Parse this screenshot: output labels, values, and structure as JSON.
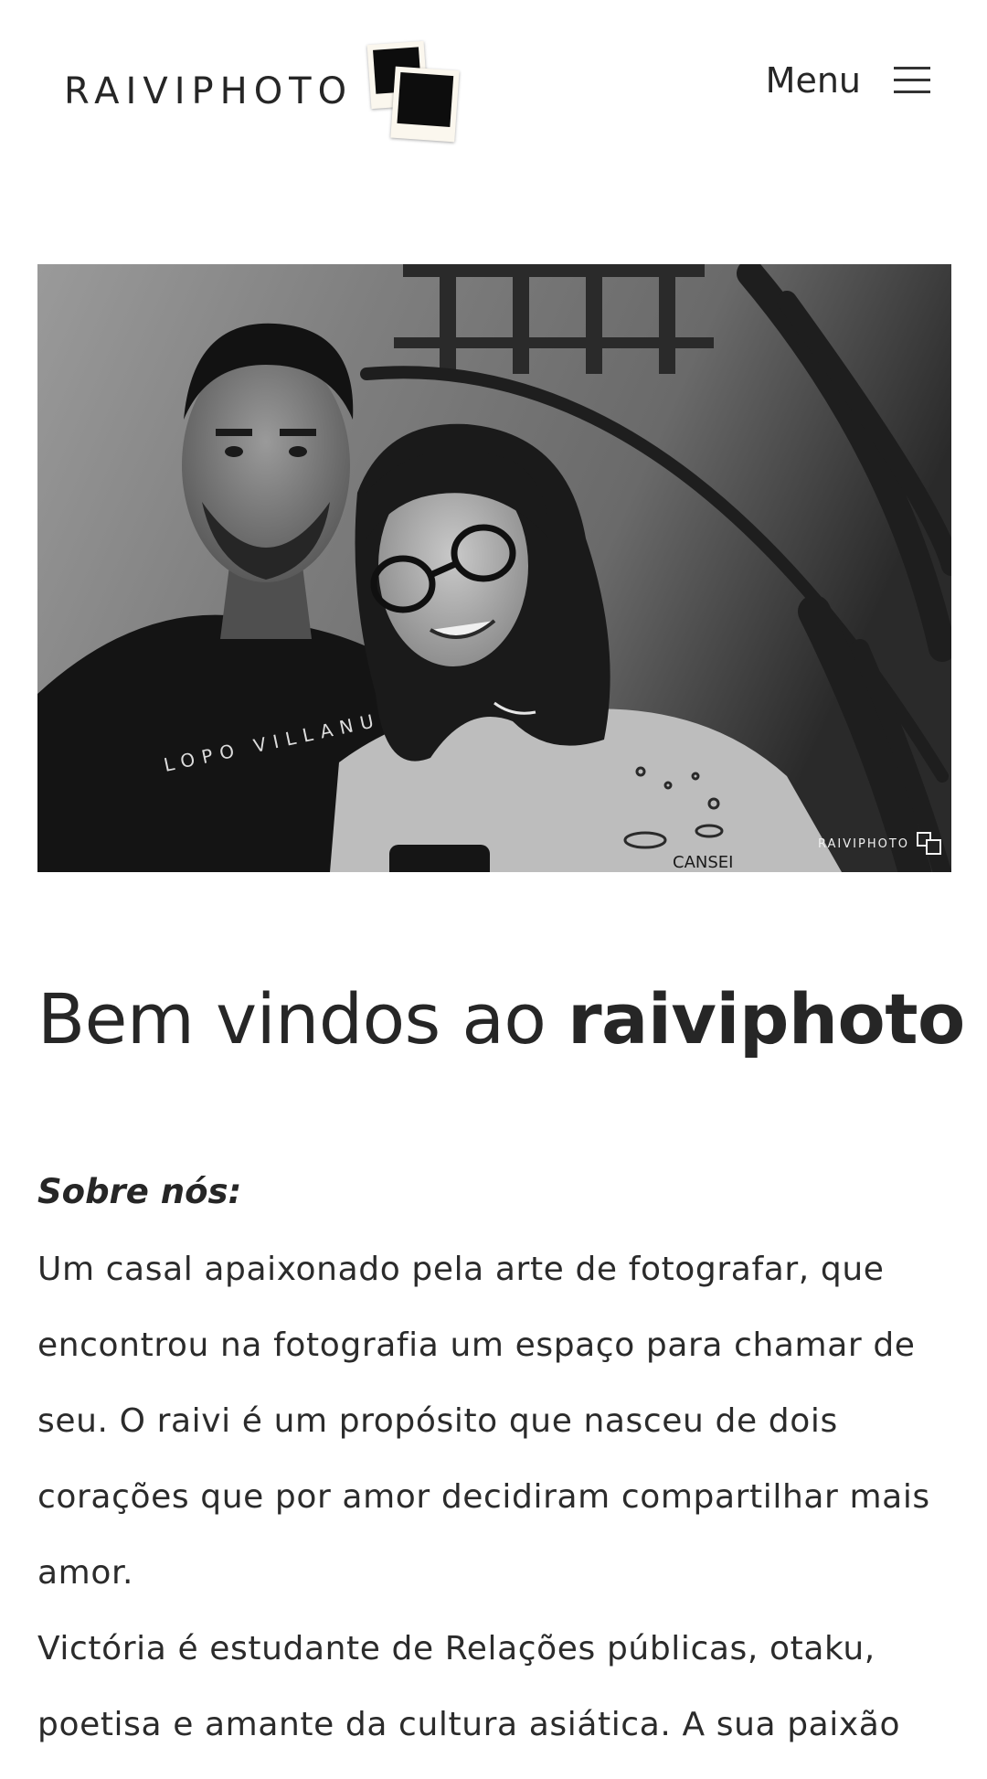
{
  "header": {
    "brand": "RAIVIPHOTO",
    "menu_label": "Menu",
    "logo_icon": "polaroid-stack-icon",
    "menu_icon": "hamburger-icon"
  },
  "hero": {
    "shirt_text": "LOPO VILLANUE",
    "shirt2_text": "CANSEI",
    "watermark": "RAIVIPHOTO"
  },
  "welcome": {
    "prefix": "Bem vindos ao ",
    "brand": "raiviphoto"
  },
  "about": {
    "heading": "Sobre nós:",
    "paragraphs": [
      "Um casal apaixonado pela arte de fotografar, que encontrou na fotografia um espaço para chamar de seu. O raivi é um propósito que nasceu de dois corações que por amor decidiram compartilhar mais amor.",
      "Victória é estudante de Relações públicas, otaku, poetisa e amante da cultura asiática. A sua paixão"
    ]
  }
}
